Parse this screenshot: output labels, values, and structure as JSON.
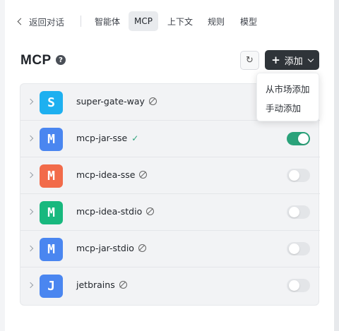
{
  "nav": {
    "back_label": "返回对话",
    "tabs": [
      {
        "label": "智能体",
        "active": false
      },
      {
        "label": "MCP",
        "active": true
      },
      {
        "label": "上下文",
        "active": false
      },
      {
        "label": "规则",
        "active": false
      },
      {
        "label": "模型",
        "active": false
      }
    ]
  },
  "header": {
    "title": "MCP",
    "help_glyph": "?",
    "refresh_glyph": "↻",
    "add_label": "添加",
    "add_plus": "+"
  },
  "dropdown": {
    "items": [
      "从市场添加",
      "手动添加"
    ]
  },
  "servers": [
    {
      "letter": "S",
      "name": "super-gate-way",
      "status": "disabled",
      "color": "#1eb0f0",
      "enabled": null
    },
    {
      "letter": "M",
      "name": "mcp-jar-sse",
      "status": "ok",
      "status_glyph": "✓",
      "color": "#4a86f0",
      "enabled": true
    },
    {
      "letter": "M",
      "name": "mcp-idea-sse",
      "status": "disabled",
      "color": "#f26b4a",
      "enabled": false
    },
    {
      "letter": "M",
      "name": "mcp-idea-stdio",
      "status": "disabled",
      "color": "#18b87e",
      "enabled": false
    },
    {
      "letter": "M",
      "name": "mcp-jar-stdio",
      "status": "disabled",
      "color": "#4a86f0",
      "enabled": false
    },
    {
      "letter": "J",
      "name": "jetbrains",
      "status": "disabled",
      "color": "#4a86f0",
      "enabled": false
    }
  ],
  "colors": {
    "accent_dark": "#2f3439",
    "toggle_on": "#2aa27a",
    "toggle_off": "#e3e5e8"
  }
}
